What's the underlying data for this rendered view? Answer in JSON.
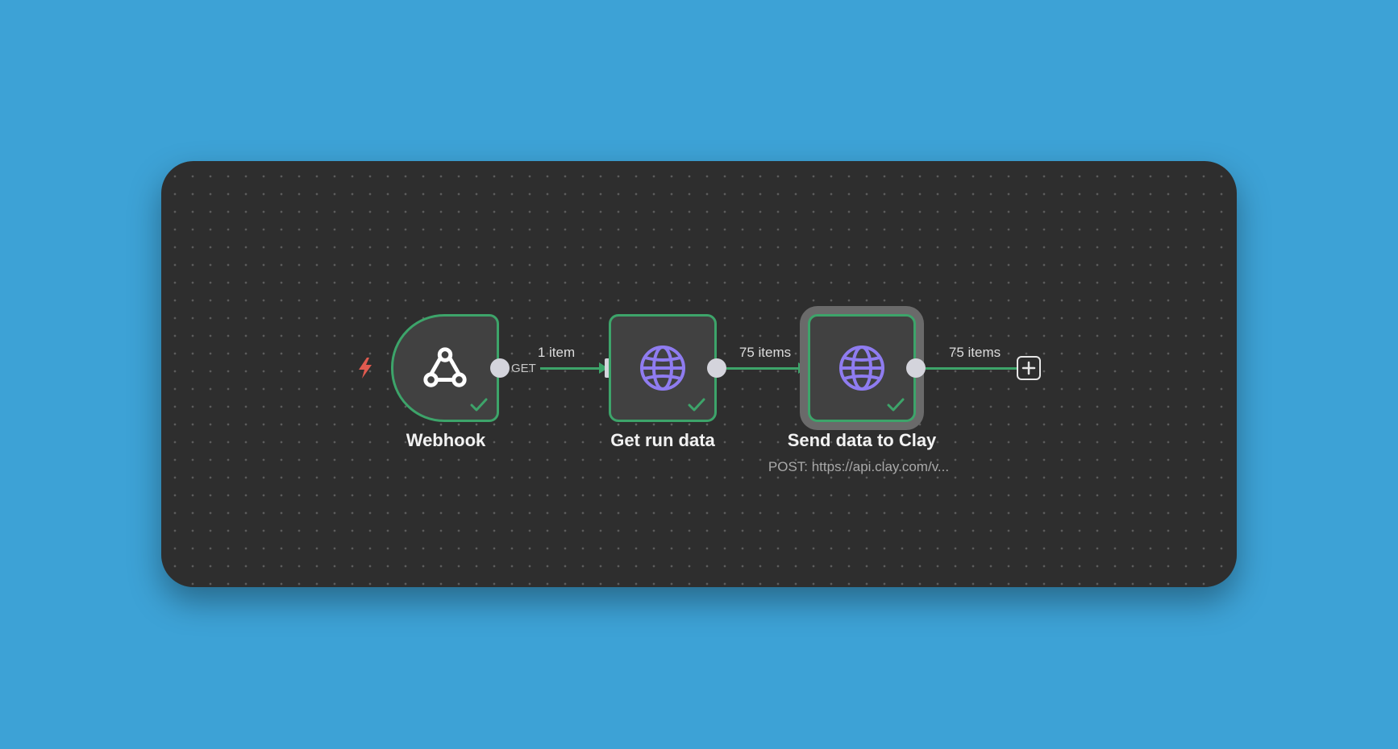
{
  "workflow": {
    "nodes": [
      {
        "id": "webhook",
        "label": "Webhook",
        "icon": "webhook-icon",
        "output_label": "GET",
        "status": "success"
      },
      {
        "id": "get-run-data",
        "label": "Get run data",
        "icon": "globe-icon",
        "status": "success"
      },
      {
        "id": "send-data-to-clay",
        "label": "Send data to Clay",
        "subtitle": "POST: https://api.clay.com/v...",
        "icon": "globe-icon",
        "status": "success",
        "selected": true
      }
    ],
    "connections": [
      {
        "from": "webhook",
        "to": "get-run-data",
        "label": "1 item"
      },
      {
        "from": "get-run-data",
        "to": "send-data-to-clay",
        "label": "75 items"
      },
      {
        "from": "send-data-to-clay",
        "to": "add-node",
        "label": "75 items"
      }
    ],
    "colors": {
      "success": "#3da46a",
      "trigger": "#e05a4f",
      "http_icon": "#8f7cf0",
      "canvas": "#2e2e2e",
      "page_background": "#3da2d6"
    },
    "icons": {
      "trigger": "lightning-bolt-icon",
      "add": "plus-square-icon",
      "status": "checkmark-icon"
    }
  }
}
